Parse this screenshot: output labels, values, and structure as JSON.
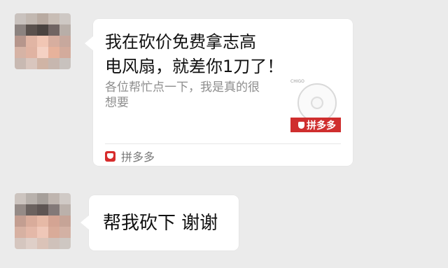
{
  "conversation": {
    "avatars": [
      {
        "name": "avatar-1",
        "pixels": [
          [
            "#c9c2be",
            "#c2b8b1",
            "#b8aaa1",
            "#c8bdb5",
            "#cec8c4"
          ],
          [
            "#8c8380",
            "#5a514d",
            "#4a4340",
            "#706462",
            "#b8aea8"
          ],
          [
            "#b6968c",
            "#e1b5a4",
            "#f1c6b4",
            "#d7ae9f",
            "#c7a89d"
          ],
          [
            "#d6b3a5",
            "#e0b3a2",
            "#f4d1c3",
            "#e7b29b",
            "#d3ab9c"
          ],
          [
            "#c8b9b2",
            "#d9c6be",
            "#d0b4a5",
            "#c7b7af",
            "#c8c2be"
          ]
        ]
      },
      {
        "name": "avatar-2",
        "pixels": [
          [
            "#ccc4bf",
            "#b8b1ac",
            "#a69f9a",
            "#bfb5af",
            "#d0cac6"
          ],
          [
            "#958b87",
            "#6b625f",
            "#5e5553",
            "#837978",
            "#bbb1ab"
          ],
          [
            "#c39e91",
            "#d9ac9b",
            "#e6b9a6",
            "#d4a493",
            "#c6a497"
          ],
          [
            "#d7b1a2",
            "#e4b8a8",
            "#efc7b8",
            "#d9ab99",
            "#d3b1a4"
          ],
          [
            "#d5c6bf",
            "#dfcfc8",
            "#dbc3b8",
            "#cfc1ba",
            "#cec7c2"
          ]
        ]
      }
    ],
    "card": {
      "title": "我在砍价免费拿志高\n电风扇，就差你1刀了！",
      "description": "各位帮忙点一下，我是真的很想要",
      "thumbnail": {
        "brand": "CHIGO",
        "badge": "拼多多",
        "icon": "pinduoduo-shield-icon"
      },
      "footer": {
        "app_name": "拼多多",
        "icon": "pinduoduo-logo-icon"
      }
    },
    "reply": {
      "text": "帮我砍下 谢谢"
    }
  },
  "colors": {
    "background": "#ebebeb",
    "bubble": "#ffffff",
    "title_text": "#111111",
    "secondary_text": "#8d8d8d",
    "brand_red": "#cf2e2e"
  }
}
